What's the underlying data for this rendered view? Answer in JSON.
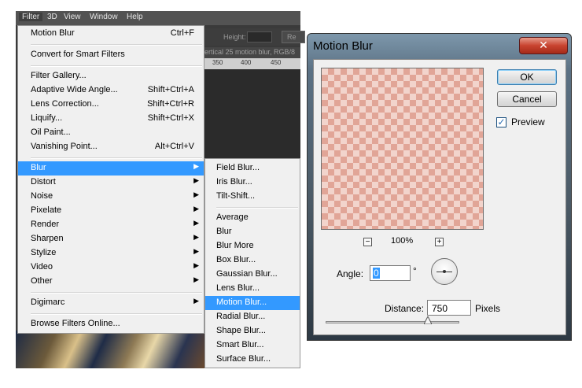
{
  "menubar": {
    "items": [
      "Filter",
      "3D",
      "View",
      "Window",
      "Help"
    ]
  },
  "options_bar": {
    "height_label": "Height:",
    "refine_label": "Re"
  },
  "document_tab": {
    "title": "ertical 25 motion blur, RGB/8"
  },
  "ruler": {
    "ticks": [
      "350",
      "400",
      "450"
    ]
  },
  "filter_menu": {
    "items": [
      {
        "label": "Motion Blur",
        "shortcut": "Ctrl+F"
      },
      {
        "label": "Convert for Smart Filters",
        "shortcut": ""
      },
      {
        "label": "Filter Gallery...",
        "shortcut": ""
      },
      {
        "label": "Adaptive Wide Angle...",
        "shortcut": "Shift+Ctrl+A"
      },
      {
        "label": "Lens Correction...",
        "shortcut": "Shift+Ctrl+R"
      },
      {
        "label": "Liquify...",
        "shortcut": "Shift+Ctrl+X"
      },
      {
        "label": "Oil Paint...",
        "shortcut": ""
      },
      {
        "label": "Vanishing Point...",
        "shortcut": "Alt+Ctrl+V"
      },
      {
        "label": "Blur",
        "shortcut": ""
      },
      {
        "label": "Distort",
        "shortcut": ""
      },
      {
        "label": "Noise",
        "shortcut": ""
      },
      {
        "label": "Pixelate",
        "shortcut": ""
      },
      {
        "label": "Render",
        "shortcut": ""
      },
      {
        "label": "Sharpen",
        "shortcut": ""
      },
      {
        "label": "Stylize",
        "shortcut": ""
      },
      {
        "label": "Video",
        "shortcut": ""
      },
      {
        "label": "Other",
        "shortcut": ""
      },
      {
        "label": "Digimarc",
        "shortcut": ""
      },
      {
        "label": "Browse Filters Online...",
        "shortcut": ""
      }
    ]
  },
  "blur_submenu": {
    "items": [
      "Field Blur...",
      "Iris Blur...",
      "Tilt-Shift...",
      "Average",
      "Blur",
      "Blur More",
      "Box Blur...",
      "Gaussian Blur...",
      "Lens Blur...",
      "Motion Blur...",
      "Radial Blur...",
      "Shape Blur...",
      "Smart Blur...",
      "Surface Blur..."
    ]
  },
  "dialog": {
    "title": "Motion Blur",
    "close_glyph": "✕",
    "ok_label": "OK",
    "cancel_label": "Cancel",
    "preview_label": "Preview",
    "preview_checked": true,
    "zoom_out_glyph": "−",
    "zoom_in_glyph": "+",
    "zoom_level": "100%",
    "angle_label": "Angle:",
    "angle_value": "0",
    "degree_sign": "°",
    "distance_label": "Distance:",
    "distance_value": "750",
    "pixels_label": "Pixels",
    "check_glyph": "✓",
    "arrow_glyph": "▶"
  },
  "colors": {
    "highlight": "#3399ff",
    "checker_dark": "#e1a597",
    "checker_light": "#f2d4cc"
  }
}
